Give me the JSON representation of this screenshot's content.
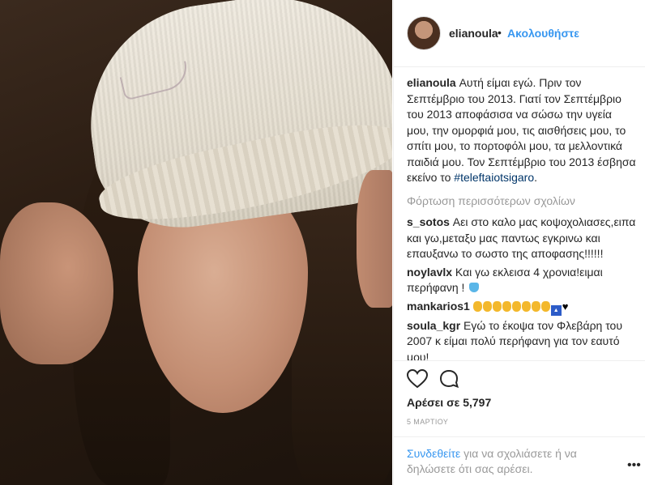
{
  "post": {
    "username": "elianoula",
    "separator": "•",
    "follow_label": "Ακολουθήστε",
    "caption_user": "elianoula",
    "caption_text": " Αυτή είμαι εγώ. Πριν τον Σεπτέμβριο του 2013. Γιατί τον Σεπτέμβριο του 2013 αποφάσισα να σώσω την υγεία μου, την ομορφιά μου, τις αισθήσεις μου, το σπίτι μου, το πορτοφόλι μου, τα μελλοντικά παιδιά μου. Τον Σεπτέμβριο του 2013 έσβησα εκείνο το ",
    "hashtag": "#teleftaiotsigaro",
    "caption_end": ".",
    "load_more": "Φόρτωση περισσότερων σχολίων",
    "comments": [
      {
        "user": "s_sotos",
        "text": " Αει στο καλο μας κοψοχολιασες,ειπα και γω,μεταξυ μας παντως εγκρινω και επαυξανω το σωστο της αποφασης!!!!!!"
      },
      {
        "user": "noylavlx",
        "text": " Και γω εκλεισα 4 χρονια!ειμαι περήφανη ! "
      },
      {
        "user": "mankarios1",
        "text": " "
      },
      {
        "user": "soula_kgr",
        "text": " Εγώ το έκοψα τον Φλεβάρη του 2007 κ είμαι πολύ περήφανη για τον εαυτό μου!"
      }
    ],
    "likes": "Αρέσει σε 5,797",
    "date": "5 ΜΑΡΤΙΟΥ",
    "login_link": "Συνδεθείτε",
    "login_text": " για να σχολιάσετε ή να δηλώσετε ότι σας αρέσει.",
    "more_dots": "•••"
  },
  "icons": {
    "like": "heart-outline-icon",
    "comment": "comment-bubble-icon",
    "emoji_blue_heart": "blue-heart-emoji",
    "emoji_clap": "clap-emoji",
    "emoji_top": "top-emoji",
    "emoji_black_heart": "black-heart-emoji"
  },
  "colors": {
    "link": "#3897f0",
    "text": "#262626",
    "muted": "#999999",
    "hashtag": "#003569"
  }
}
